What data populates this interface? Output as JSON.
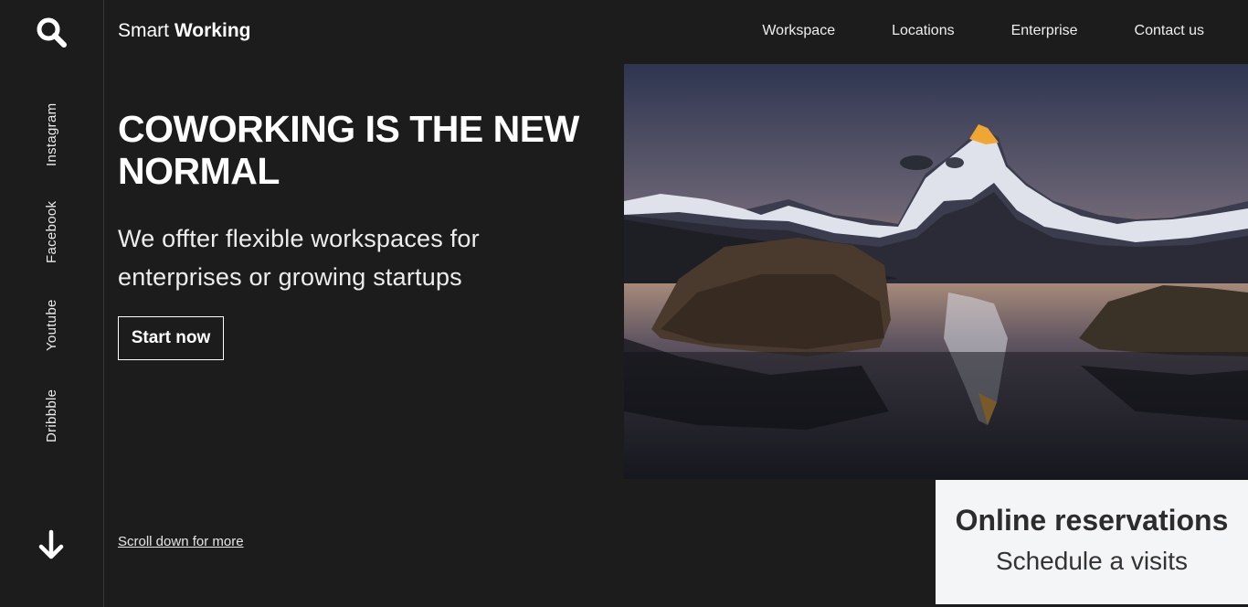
{
  "brand": {
    "light": "Smart",
    "bold": "Working"
  },
  "nav": [
    "Workspace",
    "Locations",
    "Enterprise",
    "Contact us"
  ],
  "social": [
    "Instagram",
    "Facebook",
    "Youtube",
    "Dribbble"
  ],
  "hero": {
    "headline": "COWORKING IS THE NEW NORMAL",
    "subline": "We offter flexible workspaces for enterprises or growing startups",
    "cta": "Start now",
    "scroll": "Scroll down for more"
  },
  "card": {
    "title": "Online reservations",
    "subtitle": "Schedule a visits"
  },
  "icons": {
    "search": "search-icon",
    "down": "arrow-down-icon"
  },
  "colors": {
    "background": "#1c1c1c",
    "card": "#f4f5f6",
    "text": "#ffffff"
  }
}
